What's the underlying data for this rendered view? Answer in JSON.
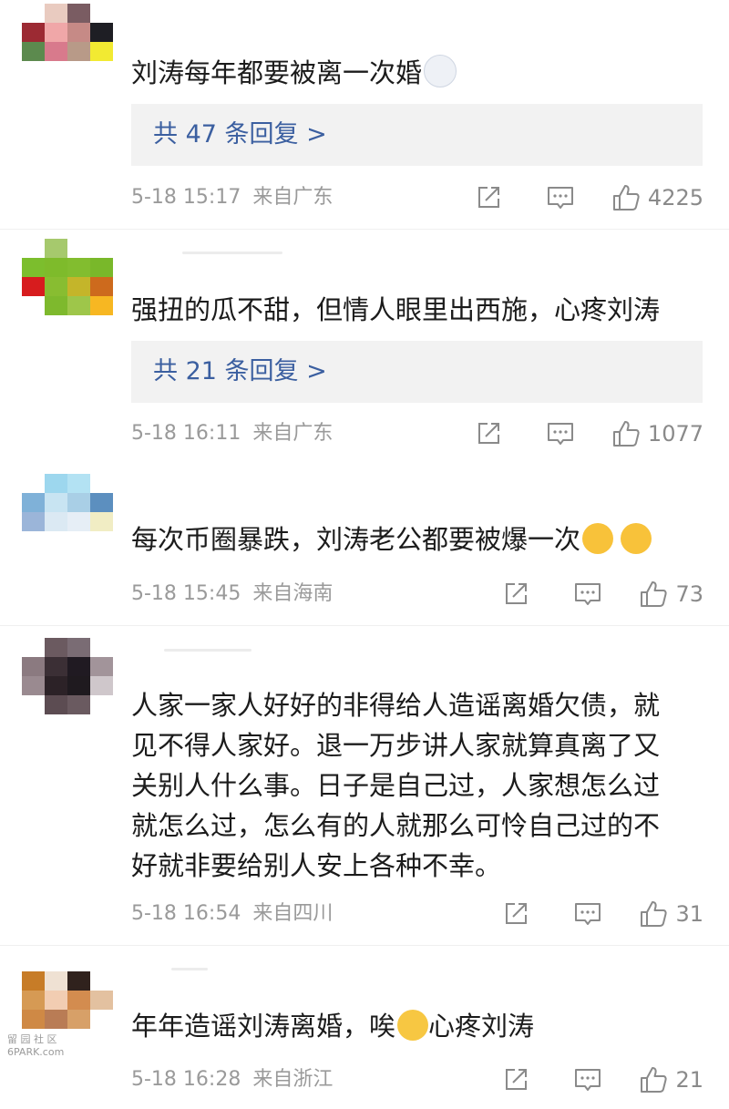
{
  "comments": [
    {
      "text": "刘涛每年都要被离一次婚",
      "emoji": [
        "husky-emoji"
      ],
      "replies": "共 47 条回复 >",
      "time": "5-18 15:17",
      "location": "来自广东",
      "likes": "4225"
    },
    {
      "text": "强扭的瓜不甜，但情人眼里出西施，心疼刘涛",
      "emoji": [],
      "replies": "共 21 条回复 >",
      "time": "5-18 16:11",
      "location": "来自广东",
      "likes": "1077"
    },
    {
      "text": "每次币圈暴跌，刘涛老公都要被爆一次",
      "emoji": [
        "crying-laughing-emoji",
        "crying-laughing-emoji"
      ],
      "replies": "",
      "time": "5-18 15:45",
      "location": "来自海南",
      "likes": "73"
    },
    {
      "text_lines": [
        "人家一家人好好的非得给人造谣离婚欠债，就",
        "见不得人家好。退一万步讲人家就算真离了又",
        "关别人什么事。日子是自己过，人家想怎么过",
        "就怎么过，怎么有的人就那么可怜自己过的不",
        "好就非要给别人安上各种不幸。"
      ],
      "time": "5-18 16:54",
      "location": "来自四川",
      "likes": "31"
    },
    {
      "text_before": "年年造谣刘涛离婚，唉",
      "text_after": "心疼刘涛",
      "emoji": [
        "pensive-emoji"
      ],
      "time": "5-18 16:28",
      "location": "来自浙江",
      "likes": "21"
    }
  ],
  "watermark": {
    "line1": "留 园 社 区",
    "line2": "6PARK.com"
  },
  "colors": {
    "reply_link": "#3b5fa0",
    "meta": "#9a9a9a",
    "reply_bg": "#f2f2f2"
  },
  "icons": [
    "share-icon",
    "comment-icon",
    "like-icon"
  ]
}
